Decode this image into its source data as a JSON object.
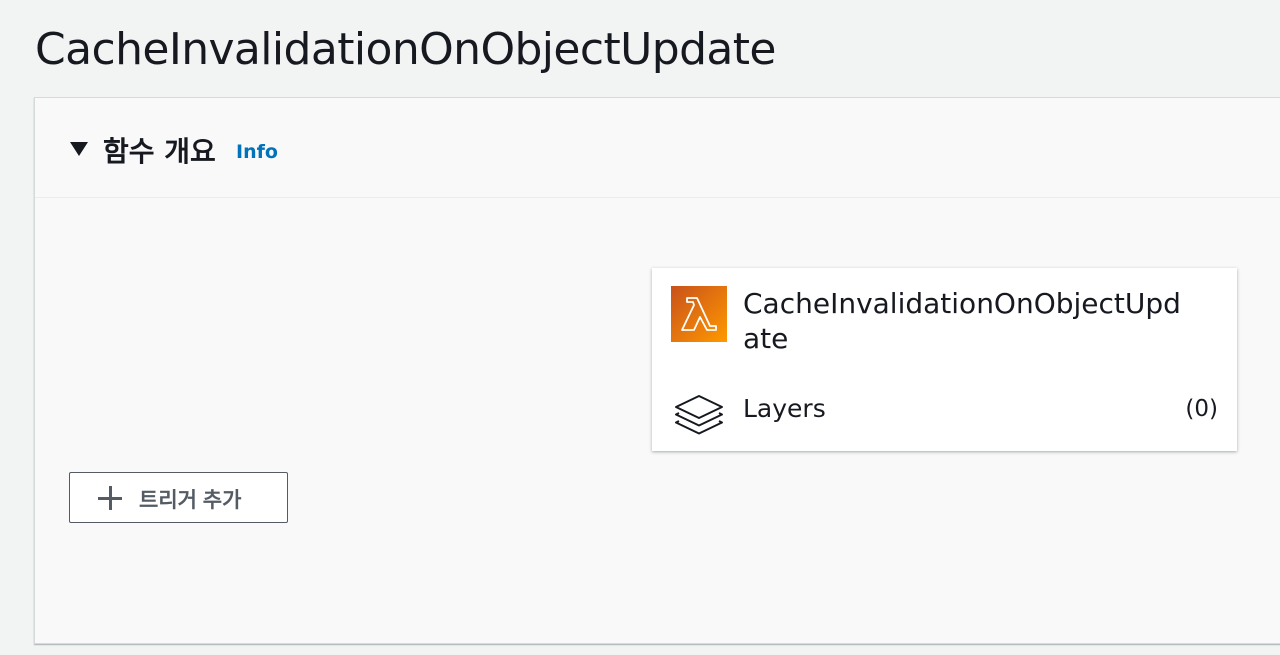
{
  "page": {
    "title": "CacheInvalidationOnObjectUpdate"
  },
  "overview_panel": {
    "heading": "함수 개요",
    "info_link": "Info",
    "expanded": true
  },
  "function_card": {
    "icon": "lambda-icon",
    "name": "CacheInvalidationOnObjectUpdate",
    "layers_icon": "layers-icon",
    "layers_label": "Layers",
    "layers_count": "(0)"
  },
  "add_trigger_button": {
    "icon": "plus-icon",
    "label": "트리거 추가"
  },
  "colors": {
    "link": "#0073bb",
    "lambda_orange_dark": "#c8511b",
    "lambda_orange_light": "#ff9900",
    "button_border": "#545b64",
    "text": "#16191f"
  }
}
